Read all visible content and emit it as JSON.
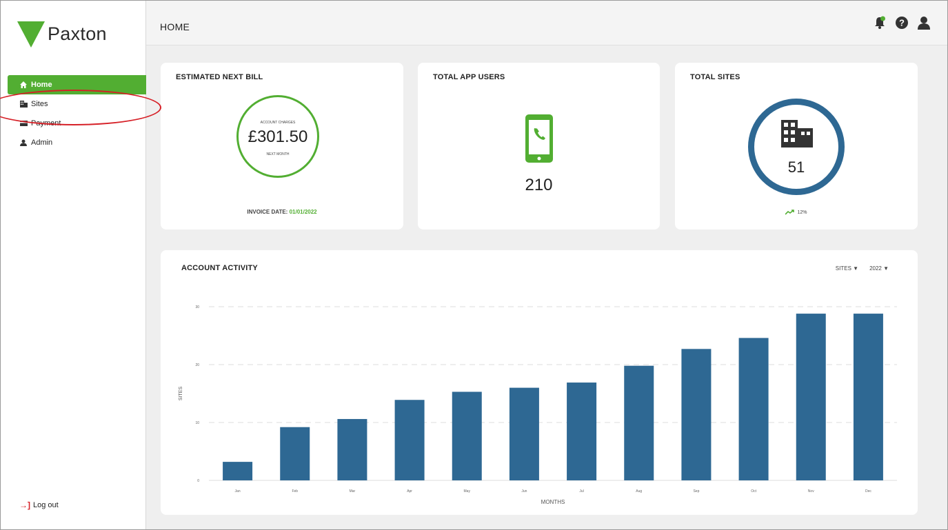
{
  "brand": {
    "name": "Paxton"
  },
  "sidebar": {
    "items": [
      {
        "label": "Home",
        "icon": "home-icon",
        "active": true
      },
      {
        "label": "Sites",
        "icon": "building-icon",
        "active": false
      },
      {
        "label": "Payment",
        "icon": "credit-card-icon",
        "active": false
      },
      {
        "label": "Admin",
        "icon": "user-icon",
        "active": false
      }
    ],
    "logout_label": "Log out"
  },
  "header": {
    "title": "HOME",
    "icons": [
      "notification-bell-icon",
      "help-icon",
      "user-icon"
    ]
  },
  "cards": {
    "bill": {
      "title": "ESTIMATED NEXT BILL",
      "top_label": "ACCOUNT CHARGES",
      "amount": "£301.50",
      "bottom_label": "NEXT MONTH",
      "invoice_label": "INVOICE DATE:",
      "invoice_date": "01/01/2022"
    },
    "users": {
      "title": "TOTAL APP USERS",
      "value": "210"
    },
    "sites": {
      "title": "TOTAL SITES",
      "value": "51",
      "trend": "12%"
    }
  },
  "activity": {
    "title": "ACCOUNT ACTIVITY",
    "filter_metric": "SITES",
    "filter_year": "2022"
  },
  "colors": {
    "accent_green": "#52ae32",
    "bar_blue": "#2e6893",
    "alert_red": "#d62027"
  },
  "chart_data": {
    "type": "bar",
    "categories": [
      "Jan",
      "Feb",
      "Mar",
      "Apr",
      "May",
      "Jun",
      "Jul",
      "Aug",
      "Sep",
      "Oct",
      "Nov",
      "Dec"
    ],
    "values": [
      3.2,
      9.2,
      10.6,
      13.9,
      15.3,
      16.0,
      16.9,
      19.8,
      22.7,
      24.6,
      28.8,
      28.8
    ],
    "xlabel": "MONTHS",
    "ylabel": "SITES",
    "yticks": [
      0,
      10,
      20,
      30
    ],
    "ylim": [
      0,
      30
    ],
    "grid": true
  }
}
